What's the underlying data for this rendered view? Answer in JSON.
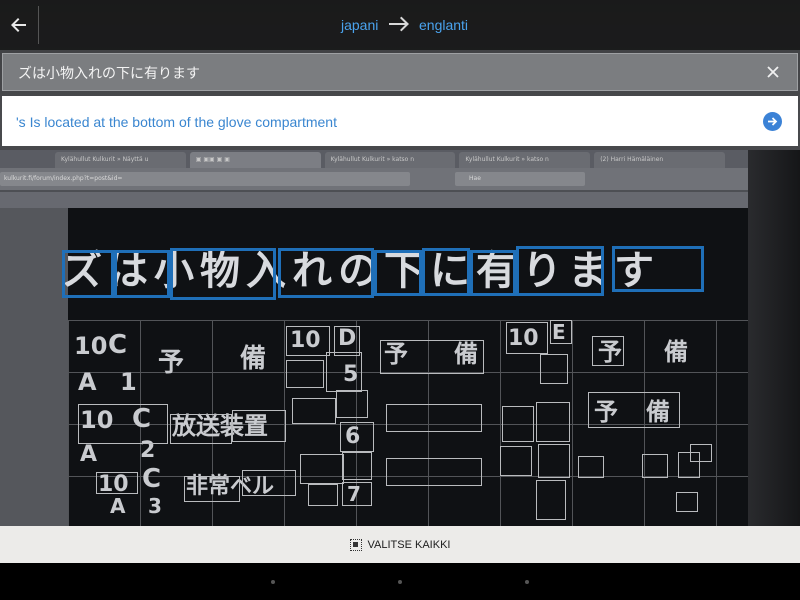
{
  "app_bar": {
    "back_icon": "arrow-back-icon",
    "source_language": "japani",
    "target_language": "englanti",
    "swap_icon": "arrow-right-icon"
  },
  "source": {
    "text": "ズは小物入れの下に有ります",
    "close_icon": "close-icon"
  },
  "translation": {
    "text": "'s Is located at the bottom of the glove compartment",
    "go_icon": "arrow-circle-right-icon"
  },
  "camera": {
    "ocr_line": "ズは小物入れの下に有ります",
    "browser_tabs": [
      "Kylähullut Kulkurit » Näyttä u",
      "▣ ▣▣ ▣ ▣",
      "Kylähullut Kulkurit » katso n",
      "Kylähullut Kulkurit » katso n",
      "(2) Harri Hämäläinen"
    ],
    "browser_url": "kulkurit.fi/forum/index.php?t=post&id=",
    "browser_search": "Hae",
    "cells": {
      "c10a": "10",
      "ca": "C",
      "a1": "A",
      "one": "1",
      "yobi": "予",
      "bi": "備",
      "c10b": "10",
      "cb": "C",
      "a2": "A",
      "two": "2",
      "housou": "放送装置",
      "c10c": "10",
      "cc": "C",
      "a3": "A",
      "three": "3",
      "hijou": "非常ベル",
      "d": "D",
      "e": "E",
      "five": "5",
      "six": "6",
      "seven": "7"
    }
  },
  "bottom_bar": {
    "select_all_label": "VALITSE KAIKKI",
    "select_icon": "select-all-icon"
  },
  "colors": {
    "accent": "#4aa3ee",
    "ocr_box": "#1f6fb8",
    "translation_text": "#3a86d0"
  }
}
